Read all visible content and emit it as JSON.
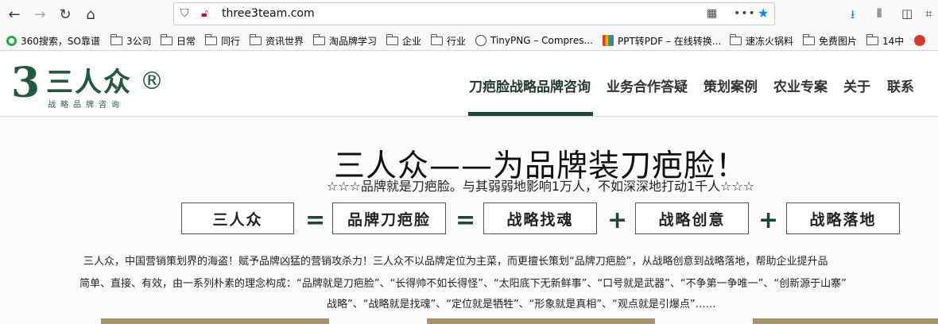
{
  "browser": {
    "url": "three3team.com",
    "bookmarks": [
      {
        "label": "360搜索，SO靠谱",
        "icon": "360-search-icon"
      },
      {
        "label": "3公司",
        "icon": "folder-icon"
      },
      {
        "label": "日常",
        "icon": "folder-icon"
      },
      {
        "label": "同行",
        "icon": "folder-icon"
      },
      {
        "label": "资讯世界",
        "icon": "folder-icon"
      },
      {
        "label": "淘品牌学习",
        "icon": "folder-icon"
      },
      {
        "label": "企业",
        "icon": "folder-icon"
      },
      {
        "label": "行业",
        "icon": "folder-icon"
      },
      {
        "label": "TinyPNG – Compres...",
        "icon": "globe-icon"
      },
      {
        "label": "PPT转PDF – 在线转换...",
        "icon": "ppt-pdf-icon"
      },
      {
        "label": "速冻火锅料",
        "icon": "folder-icon"
      },
      {
        "label": "免费图片",
        "icon": "folder-icon"
      },
      {
        "label": "14中",
        "icon": "folder-icon"
      }
    ]
  },
  "site": {
    "logo": {
      "digit": "3",
      "name": "三人众",
      "reg": "®",
      "subtitle": "战略品牌咨询"
    },
    "nav": [
      "刀疤脸战略品牌咨询",
      "业务合作答疑",
      "策划案例",
      "农业专案",
      "关于",
      "联系"
    ],
    "headline": "三人众——为品牌装刀疤脸！",
    "tagline": "☆☆☆品牌就是刀疤脸。与其弱弱地影响1万人，不如深深地打动1千人☆☆☆",
    "formula": {
      "terms": [
        "三人众",
        "品牌刀疤脸",
        "战略找魂",
        "战略创意",
        "战略落地"
      ],
      "operators": [
        "=",
        "=",
        "+",
        "+"
      ]
    },
    "intro": [
      "三人众，中国营销策划界的海盗！赋予品牌凶猛的营销攻杀力！三人众不以品牌定位为主菜，而更擅长策划“品牌刀疤脸”，从战略创意到战略落地，帮助企业提升品",
      "简单、直接、有效，由一系列朴素的理念构成：“品牌就是刀疤脸”、“长得帅不如长得怪”、“太阳底下无新鲜事”、“口号就是武器”、“不争第一争唯一”、“创新源于山寨”",
      "战略”、“战略就是找魂”、“定位就是牺牲”、“形象就是真相”、“观点就是引爆点”……"
    ]
  },
  "colors": {
    "brand_green": "#24583d",
    "nav_underline": "#1f4634",
    "star_blue": "#0a84ff"
  }
}
